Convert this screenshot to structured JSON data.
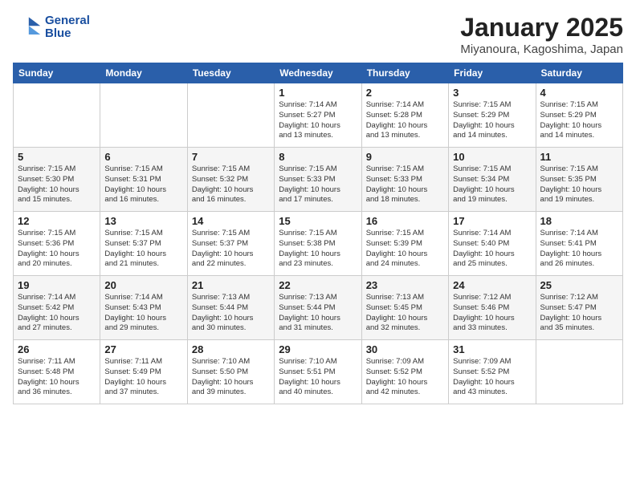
{
  "logo": {
    "line1": "General",
    "line2": "Blue"
  },
  "title": "January 2025",
  "subtitle": "Miyanoura, Kagoshima, Japan",
  "headers": [
    "Sunday",
    "Monday",
    "Tuesday",
    "Wednesday",
    "Thursday",
    "Friday",
    "Saturday"
  ],
  "weeks": [
    [
      {
        "day": "",
        "info": ""
      },
      {
        "day": "",
        "info": ""
      },
      {
        "day": "",
        "info": ""
      },
      {
        "day": "1",
        "info": "Sunrise: 7:14 AM\nSunset: 5:27 PM\nDaylight: 10 hours\nand 13 minutes."
      },
      {
        "day": "2",
        "info": "Sunrise: 7:14 AM\nSunset: 5:28 PM\nDaylight: 10 hours\nand 13 minutes."
      },
      {
        "day": "3",
        "info": "Sunrise: 7:15 AM\nSunset: 5:29 PM\nDaylight: 10 hours\nand 14 minutes."
      },
      {
        "day": "4",
        "info": "Sunrise: 7:15 AM\nSunset: 5:29 PM\nDaylight: 10 hours\nand 14 minutes."
      }
    ],
    [
      {
        "day": "5",
        "info": "Sunrise: 7:15 AM\nSunset: 5:30 PM\nDaylight: 10 hours\nand 15 minutes."
      },
      {
        "day": "6",
        "info": "Sunrise: 7:15 AM\nSunset: 5:31 PM\nDaylight: 10 hours\nand 16 minutes."
      },
      {
        "day": "7",
        "info": "Sunrise: 7:15 AM\nSunset: 5:32 PM\nDaylight: 10 hours\nand 16 minutes."
      },
      {
        "day": "8",
        "info": "Sunrise: 7:15 AM\nSunset: 5:33 PM\nDaylight: 10 hours\nand 17 minutes."
      },
      {
        "day": "9",
        "info": "Sunrise: 7:15 AM\nSunset: 5:33 PM\nDaylight: 10 hours\nand 18 minutes."
      },
      {
        "day": "10",
        "info": "Sunrise: 7:15 AM\nSunset: 5:34 PM\nDaylight: 10 hours\nand 19 minutes."
      },
      {
        "day": "11",
        "info": "Sunrise: 7:15 AM\nSunset: 5:35 PM\nDaylight: 10 hours\nand 19 minutes."
      }
    ],
    [
      {
        "day": "12",
        "info": "Sunrise: 7:15 AM\nSunset: 5:36 PM\nDaylight: 10 hours\nand 20 minutes."
      },
      {
        "day": "13",
        "info": "Sunrise: 7:15 AM\nSunset: 5:37 PM\nDaylight: 10 hours\nand 21 minutes."
      },
      {
        "day": "14",
        "info": "Sunrise: 7:15 AM\nSunset: 5:37 PM\nDaylight: 10 hours\nand 22 minutes."
      },
      {
        "day": "15",
        "info": "Sunrise: 7:15 AM\nSunset: 5:38 PM\nDaylight: 10 hours\nand 23 minutes."
      },
      {
        "day": "16",
        "info": "Sunrise: 7:15 AM\nSunset: 5:39 PM\nDaylight: 10 hours\nand 24 minutes."
      },
      {
        "day": "17",
        "info": "Sunrise: 7:14 AM\nSunset: 5:40 PM\nDaylight: 10 hours\nand 25 minutes."
      },
      {
        "day": "18",
        "info": "Sunrise: 7:14 AM\nSunset: 5:41 PM\nDaylight: 10 hours\nand 26 minutes."
      }
    ],
    [
      {
        "day": "19",
        "info": "Sunrise: 7:14 AM\nSunset: 5:42 PM\nDaylight: 10 hours\nand 27 minutes."
      },
      {
        "day": "20",
        "info": "Sunrise: 7:14 AM\nSunset: 5:43 PM\nDaylight: 10 hours\nand 29 minutes."
      },
      {
        "day": "21",
        "info": "Sunrise: 7:13 AM\nSunset: 5:44 PM\nDaylight: 10 hours\nand 30 minutes."
      },
      {
        "day": "22",
        "info": "Sunrise: 7:13 AM\nSunset: 5:44 PM\nDaylight: 10 hours\nand 31 minutes."
      },
      {
        "day": "23",
        "info": "Sunrise: 7:13 AM\nSunset: 5:45 PM\nDaylight: 10 hours\nand 32 minutes."
      },
      {
        "day": "24",
        "info": "Sunrise: 7:12 AM\nSunset: 5:46 PM\nDaylight: 10 hours\nand 33 minutes."
      },
      {
        "day": "25",
        "info": "Sunrise: 7:12 AM\nSunset: 5:47 PM\nDaylight: 10 hours\nand 35 minutes."
      }
    ],
    [
      {
        "day": "26",
        "info": "Sunrise: 7:11 AM\nSunset: 5:48 PM\nDaylight: 10 hours\nand 36 minutes."
      },
      {
        "day": "27",
        "info": "Sunrise: 7:11 AM\nSunset: 5:49 PM\nDaylight: 10 hours\nand 37 minutes."
      },
      {
        "day": "28",
        "info": "Sunrise: 7:10 AM\nSunset: 5:50 PM\nDaylight: 10 hours\nand 39 minutes."
      },
      {
        "day": "29",
        "info": "Sunrise: 7:10 AM\nSunset: 5:51 PM\nDaylight: 10 hours\nand 40 minutes."
      },
      {
        "day": "30",
        "info": "Sunrise: 7:09 AM\nSunset: 5:52 PM\nDaylight: 10 hours\nand 42 minutes."
      },
      {
        "day": "31",
        "info": "Sunrise: 7:09 AM\nSunset: 5:52 PM\nDaylight: 10 hours\nand 43 minutes."
      },
      {
        "day": "",
        "info": ""
      }
    ]
  ]
}
